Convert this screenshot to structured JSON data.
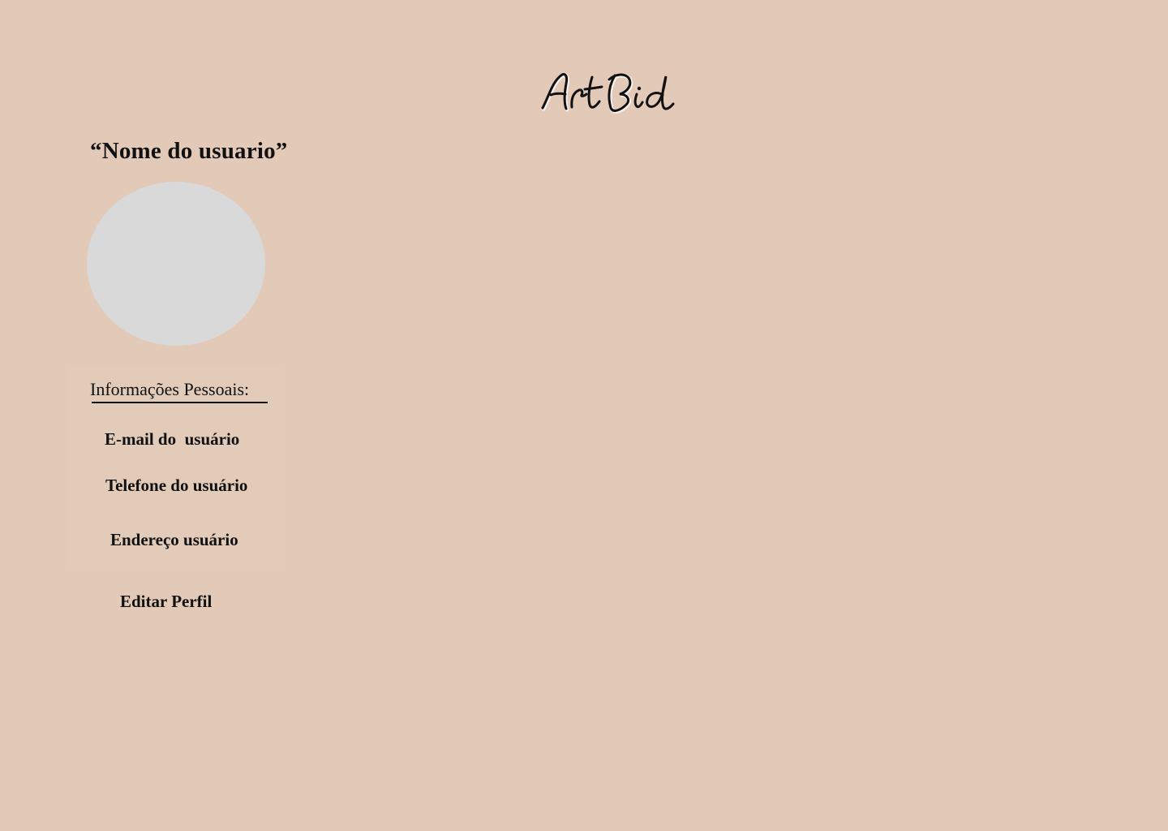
{
  "colors": {
    "background": "#e2c9b8",
    "avatar": "#d9d9d9",
    "panel": "#e3cbb9",
    "text": "#111111"
  },
  "header": {
    "logo_text": "ArtBid"
  },
  "profile": {
    "user_name": "“Nome do usuario”",
    "avatar_icon": "avatar-placeholder"
  },
  "personal_info": {
    "heading": "Informações Pessoais:",
    "email": "E-mail do  usuário",
    "phone": "Telefone do usuário",
    "address": "Endereço usuário"
  },
  "actions": {
    "edit_profile_label": "Editar Perfil"
  }
}
